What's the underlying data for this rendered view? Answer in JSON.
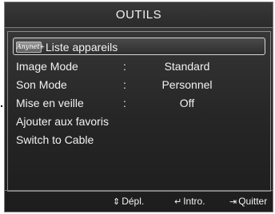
{
  "title": "OUTILS",
  "menu": [
    {
      "label": "Liste appareils",
      "icon": "anynet-logo",
      "logo_text": "Anynet+",
      "selected": true
    },
    {
      "label": "Image Mode",
      "separator": ":",
      "value": "Standard"
    },
    {
      "label": "Son Mode",
      "separator": ":",
      "value": "Personnel"
    },
    {
      "label": "Mise en veille",
      "separator": ":",
      "value": "Off"
    },
    {
      "label": "Ajouter aux favoris"
    },
    {
      "label": "Switch to Cable"
    }
  ],
  "footer": {
    "move_icon": "up-down-arrows-icon",
    "move_glyph": "⇕",
    "move": "Dépl.",
    "enter_icon": "enter-icon",
    "enter_glyph": "↵",
    "enter": "Intro.",
    "exit_icon": "exit-icon",
    "exit_glyph": "⇥",
    "exit": "Quitter"
  }
}
